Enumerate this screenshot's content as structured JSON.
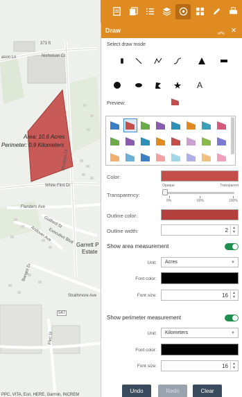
{
  "map": {
    "streets": [
      "373 ft",
      "Nicholson Ct",
      "ason Ln",
      "Sheridan Dr",
      "White Flint Dr",
      "Flanders Ave",
      "Guilford St",
      "Executive Blvd",
      "Andover Ave",
      "Bangor Dr",
      "Strathmore Ave",
      "Flint St",
      "547"
    ],
    "measure_area": "Area: 10.6 Acres",
    "measure_perimeter": "Perimeter: 0.9 Kilometers",
    "place_line1": "Garrett P",
    "place_line2": "Estate",
    "attribution": "PPC, VITA, Esri, HERE, Garmin, INCREM"
  },
  "toolbar": {
    "icons": [
      "layer-list-icon",
      "basemap-icon",
      "list-icon",
      "layers-icon",
      "draw-icon",
      "apps-icon",
      "pencil-icon",
      "print-icon"
    ]
  },
  "panel": {
    "title": "Draw",
    "select_mode": "Select draw mode",
    "preview": "Preview:",
    "color_label": "Color:",
    "color_value": "#c44e4a",
    "transparency_label": "Transparency:",
    "transparency_opaque": "Opaque",
    "transparent_label": "Transparent",
    "ticks": [
      "0%",
      "50%",
      "100%"
    ],
    "outline_color_label": "Outline color:",
    "outline_color_value": "#b3403d",
    "outline_width_label": "Outline width:",
    "outline_width_value": "2",
    "show_area": "Show area measurement",
    "area_unit_label": "Unit:",
    "area_unit_value": "Acres",
    "area_font_color_label": "Font color:",
    "area_font_size_label": "Font size:",
    "area_font_size_value": "16",
    "show_perimeter": "Show perimeter measurement",
    "perim_unit_label": "Unit:",
    "perim_unit_value": "Kilometers",
    "perim_font_color_label": "Font color:",
    "perim_font_size_label": "Font size:",
    "perim_font_size_value": "16",
    "undo": "Undo",
    "redo": "Redo",
    "clear": "Clear",
    "text_tool": "A"
  },
  "colors": {
    "accent": "#e08a22",
    "polygon": "#c44e4a",
    "toggle_on": "#1e8f4f",
    "button_dark": "#3b4b5e"
  }
}
